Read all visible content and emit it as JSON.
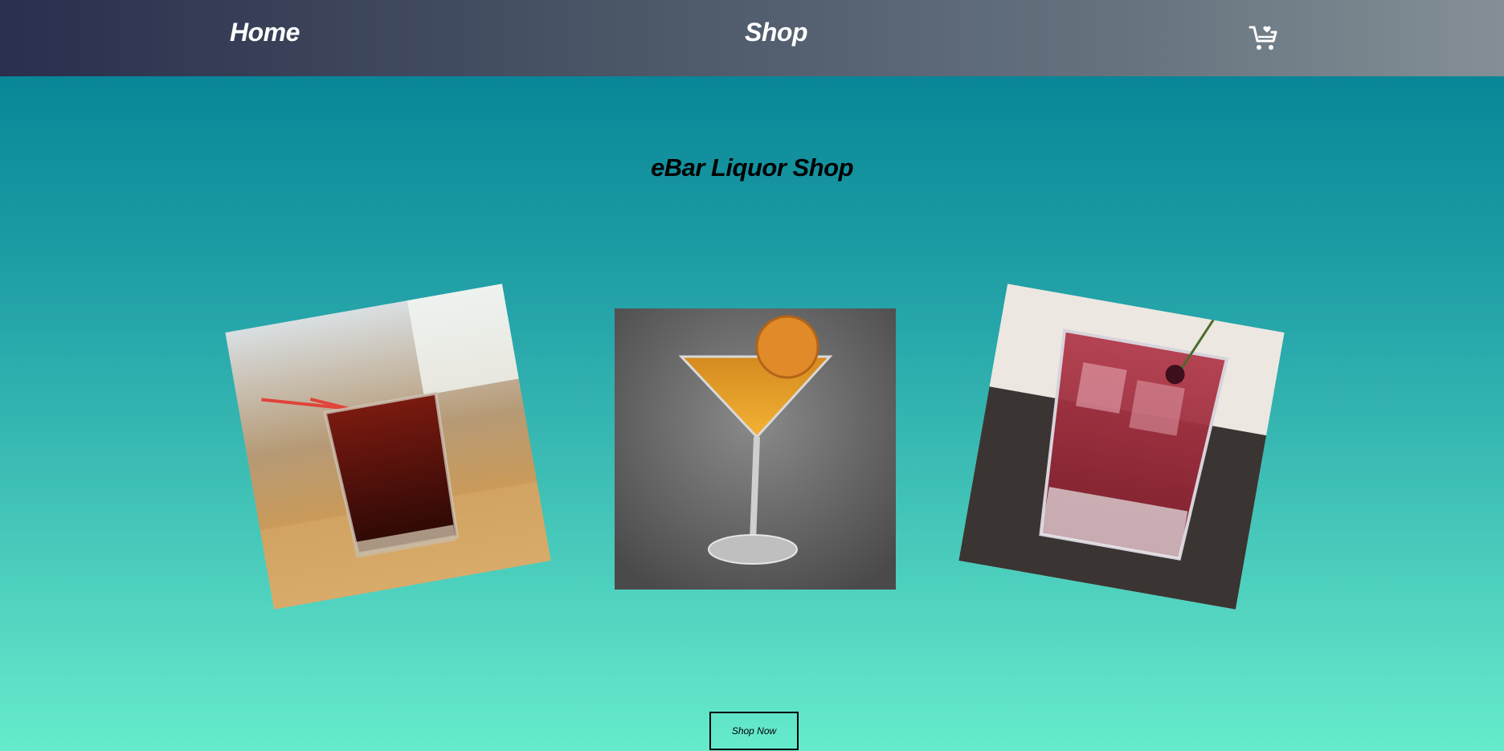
{
  "nav": {
    "home_label": "Home",
    "shop_label": "Shop",
    "cart_icon": "cart-icon"
  },
  "main": {
    "title": "eBar Liquor Shop",
    "photos": [
      {
        "icon": "cocktail-rocks-glass-photo",
        "alt": ""
      },
      {
        "icon": "martini-glass-photo",
        "alt": ""
      },
      {
        "icon": "cherry-drink-photo",
        "alt": ""
      }
    ],
    "shop_now_label": "Shop Now"
  },
  "colors": {
    "nav_gradient_start": "#292f4d",
    "nav_gradient_end": "#848f95",
    "bg_gradient_top": "#037b94",
    "bg_gradient_bottom": "#66ebcc",
    "nav_text": "#ffffff",
    "title_text": "#000000"
  }
}
